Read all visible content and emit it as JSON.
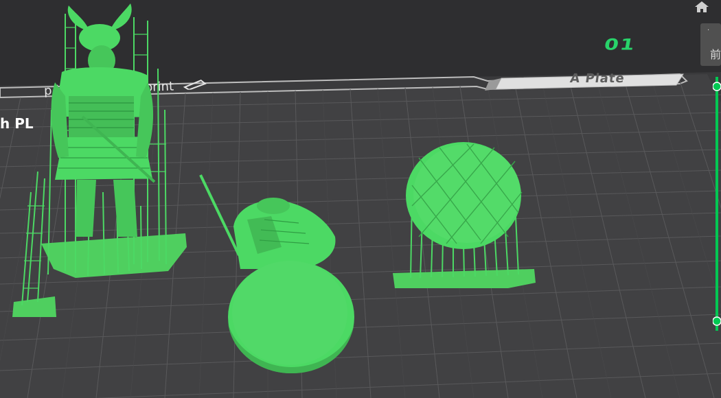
{
  "plate": {
    "name": "A Plate",
    "number": "01",
    "notice": "p     ly glue before print",
    "filament": "h PL"
  },
  "side_widget": {
    "top_label": ".",
    "glyph": "前"
  },
  "colors": {
    "model_green": "#4cd964",
    "accent_green": "#00c853",
    "bed_dark": "#3a3a3c",
    "grid_line": "#4c4c4e"
  },
  "icons": {
    "home": "home-icon",
    "edit": "pencil-icon"
  }
}
